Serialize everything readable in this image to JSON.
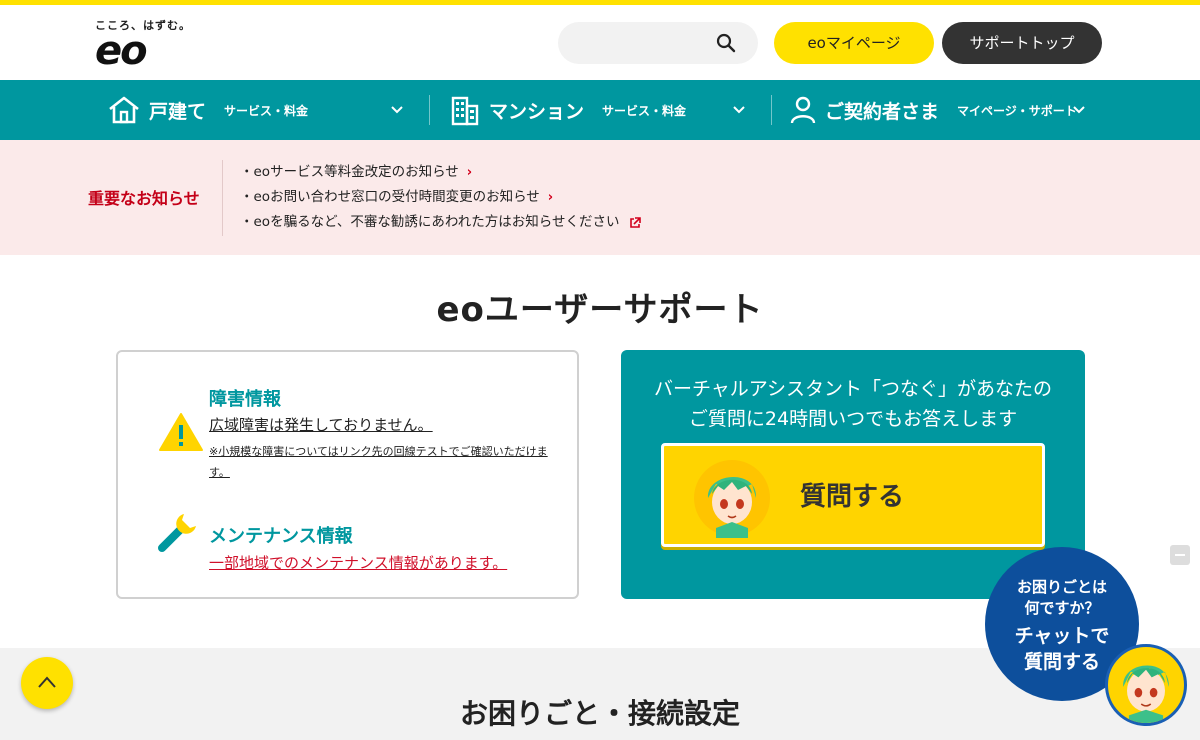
{
  "brand": {
    "tagline": "こころ、はずむ。",
    "logo": "eo"
  },
  "header": {
    "search_placeholder": "",
    "mypage_label": "eoマイページ",
    "support_top_label": "サポートトップ"
  },
  "nav": {
    "items": [
      {
        "main": "戸建て",
        "sub": "サービス・料金",
        "icon": "house-icon"
      },
      {
        "main": "マンション",
        "sub": "サービス・料金",
        "icon": "building-icon"
      },
      {
        "main": "ご契約者さま",
        "sub": "マイページ・サポート",
        "icon": "person-icon"
      }
    ]
  },
  "notice": {
    "label": "重要なお知らせ",
    "items": [
      {
        "text": "・eoサービス等料金改定のお知らせ",
        "marker": "›"
      },
      {
        "text": "・eoお問い合わせ窓口の受付時間変更のお知らせ",
        "marker": "›"
      },
      {
        "text": "・eoを騙るなど、不審な勧誘にあわれた方はお知らせください",
        "marker": "external-link-icon"
      }
    ]
  },
  "page_title": "eoユーザーサポート",
  "status": {
    "outage_heading": "障害情報",
    "outage_text": "広域障害は発生しておりません。",
    "outage_note": "※小規模な障害についてはリンク先の回線テストでご確認いただけます。",
    "maintenance_heading": "メンテナンス情報",
    "maintenance_text": "一部地域でのメンテナンス情報があります。"
  },
  "assistant": {
    "line1": "バーチャルアシスタント「つなぐ」があなたの",
    "line2": "ご質問に24時間いつでもお答えします",
    "button_label": "質問する"
  },
  "chat": {
    "line1": "お困りごとは",
    "line2": "何ですか？",
    "line3": "チャットで",
    "line4": "質問する"
  },
  "bottom_title": "お困りごと・接続設定",
  "colors": {
    "brand_yellow": "#ffe100",
    "teal": "#00979f",
    "notice_red": "#c40018",
    "chat_blue": "#0d4f9c"
  }
}
